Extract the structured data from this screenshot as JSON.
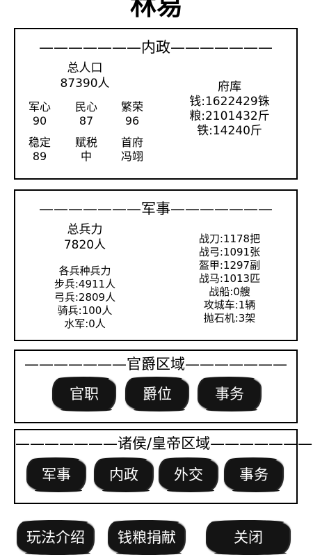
{
  "title": "林易",
  "neizheng": {
    "heading": "———————内政———————",
    "population_label": "总人口",
    "population_value": "87390人",
    "stats": [
      {
        "label": "军心",
        "value": "90"
      },
      {
        "label": "民心",
        "value": "87"
      },
      {
        "label": "繁荣",
        "value": "96"
      },
      {
        "label": "稳定",
        "value": "89"
      },
      {
        "label": "赋税",
        "value": "中"
      },
      {
        "label": "首府",
        "value": "冯翊"
      }
    ],
    "treasury_label": "府库",
    "treasury": [
      "钱:1622429铢",
      "粮:2101432斤",
      "铁:14240斤"
    ]
  },
  "junshi": {
    "heading": "———————军事———————",
    "total_troops_label": "总兵力",
    "total_troops_value": "7820人",
    "branches_label": "各兵种兵力",
    "branches": [
      "步兵:4911人",
      "弓兵:2809人",
      "骑兵:100人",
      "水军:0人"
    ],
    "equipment": [
      "战刀:1178把",
      "战弓:1091张",
      "盔甲:1297副",
      "战马:1013匹",
      "战船:0艘",
      "攻城车:1辆",
      "抛石机:3架"
    ]
  },
  "guanjue": {
    "heading": "———————官爵区域———————",
    "buttons": [
      "官职",
      "爵位",
      "事务"
    ]
  },
  "zhuhou": {
    "heading": "———————诸侯/皇帝区域———————",
    "buttons": [
      "军事",
      "内政",
      "外交",
      "事务"
    ]
  },
  "bottom_buttons": [
    "玩法介绍",
    "钱粮捐献",
    "关闭"
  ]
}
